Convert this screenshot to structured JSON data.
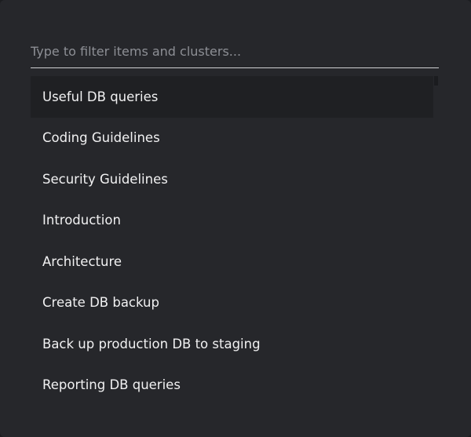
{
  "search": {
    "value": "",
    "placeholder": "Type to filter items and clusters..."
  },
  "items": [
    {
      "label": "Useful DB queries",
      "selected": true
    },
    {
      "label": "Coding Guidelines",
      "selected": false
    },
    {
      "label": "Security Guidelines",
      "selected": false
    },
    {
      "label": "Introduction",
      "selected": false
    },
    {
      "label": "Architecture",
      "selected": false
    },
    {
      "label": "Create DB backup",
      "selected": false
    },
    {
      "label": "Back up production DB to staging",
      "selected": false
    },
    {
      "label": "Reporting DB queries",
      "selected": false
    }
  ],
  "colors": {
    "panel_background": "#26272b",
    "selected_background": "#1f2023",
    "text": "#f1f1f2",
    "placeholder": "#8d8f95",
    "underline": "#cfd0d3"
  }
}
